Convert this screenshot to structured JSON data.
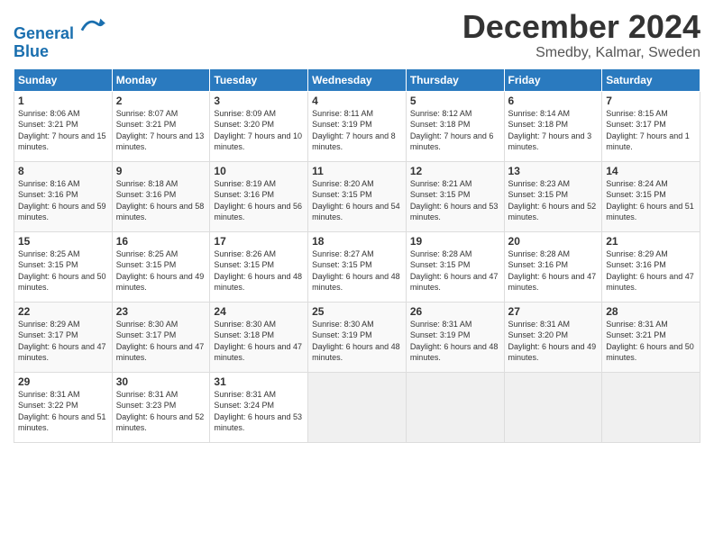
{
  "header": {
    "logo_line1": "General",
    "logo_line2": "Blue",
    "month": "December 2024",
    "location": "Smedby, Kalmar, Sweden"
  },
  "weekdays": [
    "Sunday",
    "Monday",
    "Tuesday",
    "Wednesday",
    "Thursday",
    "Friday",
    "Saturday"
  ],
  "weeks": [
    [
      {
        "day": "1",
        "sunrise": "Sunrise: 8:06 AM",
        "sunset": "Sunset: 3:21 PM",
        "daylight": "Daylight: 7 hours and 15 minutes."
      },
      {
        "day": "2",
        "sunrise": "Sunrise: 8:07 AM",
        "sunset": "Sunset: 3:21 PM",
        "daylight": "Daylight: 7 hours and 13 minutes."
      },
      {
        "day": "3",
        "sunrise": "Sunrise: 8:09 AM",
        "sunset": "Sunset: 3:20 PM",
        "daylight": "Daylight: 7 hours and 10 minutes."
      },
      {
        "day": "4",
        "sunrise": "Sunrise: 8:11 AM",
        "sunset": "Sunset: 3:19 PM",
        "daylight": "Daylight: 7 hours and 8 minutes."
      },
      {
        "day": "5",
        "sunrise": "Sunrise: 8:12 AM",
        "sunset": "Sunset: 3:18 PM",
        "daylight": "Daylight: 7 hours and 6 minutes."
      },
      {
        "day": "6",
        "sunrise": "Sunrise: 8:14 AM",
        "sunset": "Sunset: 3:18 PM",
        "daylight": "Daylight: 7 hours and 3 minutes."
      },
      {
        "day": "7",
        "sunrise": "Sunrise: 8:15 AM",
        "sunset": "Sunset: 3:17 PM",
        "daylight": "Daylight: 7 hours and 1 minute."
      }
    ],
    [
      {
        "day": "8",
        "sunrise": "Sunrise: 8:16 AM",
        "sunset": "Sunset: 3:16 PM",
        "daylight": "Daylight: 6 hours and 59 minutes."
      },
      {
        "day": "9",
        "sunrise": "Sunrise: 8:18 AM",
        "sunset": "Sunset: 3:16 PM",
        "daylight": "Daylight: 6 hours and 58 minutes."
      },
      {
        "day": "10",
        "sunrise": "Sunrise: 8:19 AM",
        "sunset": "Sunset: 3:16 PM",
        "daylight": "Daylight: 6 hours and 56 minutes."
      },
      {
        "day": "11",
        "sunrise": "Sunrise: 8:20 AM",
        "sunset": "Sunset: 3:15 PM",
        "daylight": "Daylight: 6 hours and 54 minutes."
      },
      {
        "day": "12",
        "sunrise": "Sunrise: 8:21 AM",
        "sunset": "Sunset: 3:15 PM",
        "daylight": "Daylight: 6 hours and 53 minutes."
      },
      {
        "day": "13",
        "sunrise": "Sunrise: 8:23 AM",
        "sunset": "Sunset: 3:15 PM",
        "daylight": "Daylight: 6 hours and 52 minutes."
      },
      {
        "day": "14",
        "sunrise": "Sunrise: 8:24 AM",
        "sunset": "Sunset: 3:15 PM",
        "daylight": "Daylight: 6 hours and 51 minutes."
      }
    ],
    [
      {
        "day": "15",
        "sunrise": "Sunrise: 8:25 AM",
        "sunset": "Sunset: 3:15 PM",
        "daylight": "Daylight: 6 hours and 50 minutes."
      },
      {
        "day": "16",
        "sunrise": "Sunrise: 8:25 AM",
        "sunset": "Sunset: 3:15 PM",
        "daylight": "Daylight: 6 hours and 49 minutes."
      },
      {
        "day": "17",
        "sunrise": "Sunrise: 8:26 AM",
        "sunset": "Sunset: 3:15 PM",
        "daylight": "Daylight: 6 hours and 48 minutes."
      },
      {
        "day": "18",
        "sunrise": "Sunrise: 8:27 AM",
        "sunset": "Sunset: 3:15 PM",
        "daylight": "Daylight: 6 hours and 48 minutes."
      },
      {
        "day": "19",
        "sunrise": "Sunrise: 8:28 AM",
        "sunset": "Sunset: 3:15 PM",
        "daylight": "Daylight: 6 hours and 47 minutes."
      },
      {
        "day": "20",
        "sunrise": "Sunrise: 8:28 AM",
        "sunset": "Sunset: 3:16 PM",
        "daylight": "Daylight: 6 hours and 47 minutes."
      },
      {
        "day": "21",
        "sunrise": "Sunrise: 8:29 AM",
        "sunset": "Sunset: 3:16 PM",
        "daylight": "Daylight: 6 hours and 47 minutes."
      }
    ],
    [
      {
        "day": "22",
        "sunrise": "Sunrise: 8:29 AM",
        "sunset": "Sunset: 3:17 PM",
        "daylight": "Daylight: 6 hours and 47 minutes."
      },
      {
        "day": "23",
        "sunrise": "Sunrise: 8:30 AM",
        "sunset": "Sunset: 3:17 PM",
        "daylight": "Daylight: 6 hours and 47 minutes."
      },
      {
        "day": "24",
        "sunrise": "Sunrise: 8:30 AM",
        "sunset": "Sunset: 3:18 PM",
        "daylight": "Daylight: 6 hours and 47 minutes."
      },
      {
        "day": "25",
        "sunrise": "Sunrise: 8:30 AM",
        "sunset": "Sunset: 3:19 PM",
        "daylight": "Daylight: 6 hours and 48 minutes."
      },
      {
        "day": "26",
        "sunrise": "Sunrise: 8:31 AM",
        "sunset": "Sunset: 3:19 PM",
        "daylight": "Daylight: 6 hours and 48 minutes."
      },
      {
        "day": "27",
        "sunrise": "Sunrise: 8:31 AM",
        "sunset": "Sunset: 3:20 PM",
        "daylight": "Daylight: 6 hours and 49 minutes."
      },
      {
        "day": "28",
        "sunrise": "Sunrise: 8:31 AM",
        "sunset": "Sunset: 3:21 PM",
        "daylight": "Daylight: 6 hours and 50 minutes."
      }
    ],
    [
      {
        "day": "29",
        "sunrise": "Sunrise: 8:31 AM",
        "sunset": "Sunset: 3:22 PM",
        "daylight": "Daylight: 6 hours and 51 minutes."
      },
      {
        "day": "30",
        "sunrise": "Sunrise: 8:31 AM",
        "sunset": "Sunset: 3:23 PM",
        "daylight": "Daylight: 6 hours and 52 minutes."
      },
      {
        "day": "31",
        "sunrise": "Sunrise: 8:31 AM",
        "sunset": "Sunset: 3:24 PM",
        "daylight": "Daylight: 6 hours and 53 minutes."
      },
      null,
      null,
      null,
      null
    ]
  ]
}
